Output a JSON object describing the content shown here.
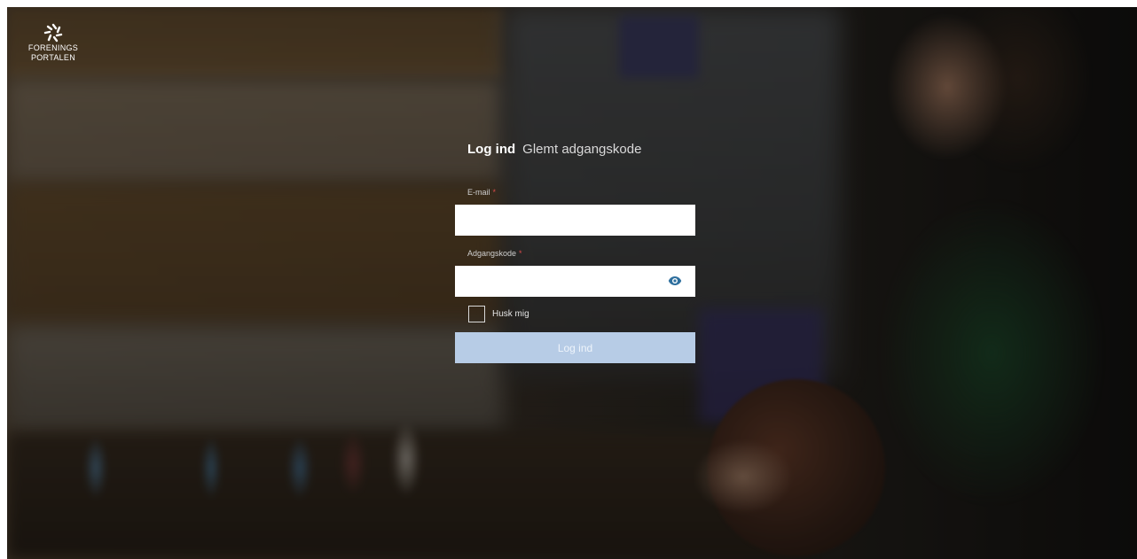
{
  "brand": {
    "logo_line_1": "FORENINGS",
    "logo_line_2": "PORTALEN",
    "logo_icon": "foreningsportalen-logo-icon"
  },
  "tabs": {
    "login": "Log ind",
    "forgot_password": "Glemt adgangskode"
  },
  "form": {
    "email_label": "E-mail",
    "email_required": "*",
    "email_value": "",
    "password_label": "Adgangskode",
    "password_required": "*",
    "password_value": "",
    "show_password_icon": "eye-icon",
    "remember_label": "Husk mig",
    "remember_checked": false,
    "submit_label": "Log ind"
  },
  "colors": {
    "accent_button": "#b7cce6",
    "eye_icon": "#2e6f9e",
    "required_mark": "#d84a4a"
  }
}
